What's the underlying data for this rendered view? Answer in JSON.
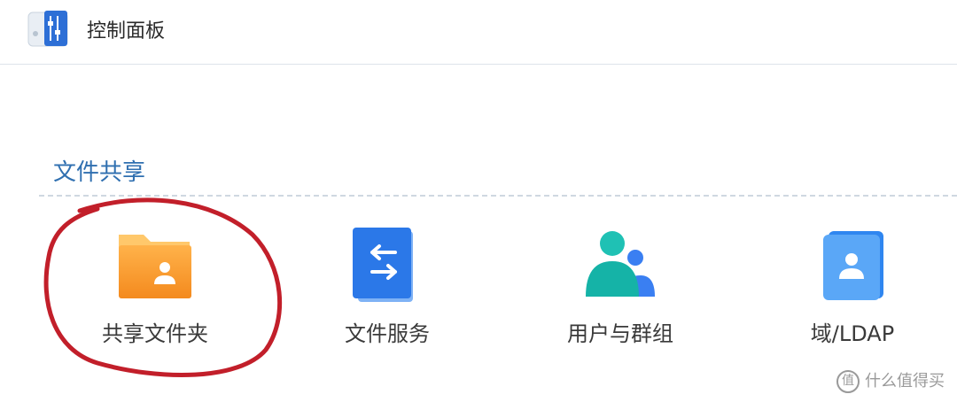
{
  "window": {
    "title": "控制面板",
    "icon": "control-panel-icon"
  },
  "section": {
    "title": "文件共享",
    "accent_color": "#2f6fb0",
    "items": [
      {
        "label": "共享文件夹",
        "icon": "shared-folder-icon",
        "highlighted": true
      },
      {
        "label": "文件服务",
        "icon": "file-services-icon"
      },
      {
        "label": "用户与群组",
        "icon": "user-group-icon"
      },
      {
        "label": "域/LDAP",
        "icon": "domain-ldap-icon"
      }
    ]
  },
  "annotation": {
    "type": "hand-drawn-circle",
    "color": "#c21f2a",
    "target": "共享文件夹"
  },
  "watermark": {
    "badge": "值",
    "text": "什么值得买"
  }
}
